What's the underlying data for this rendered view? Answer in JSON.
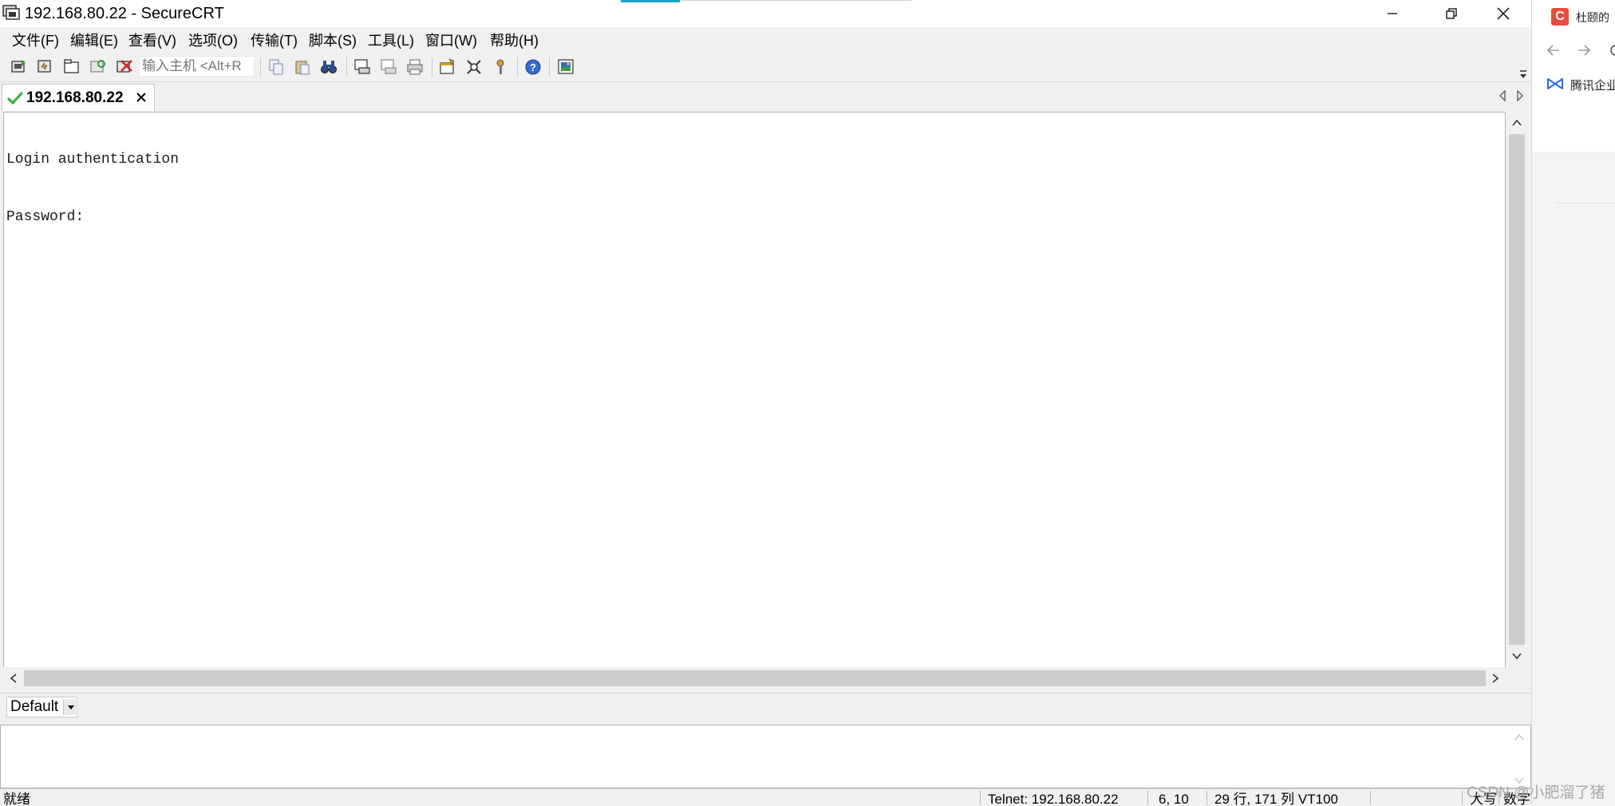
{
  "window": {
    "title": "192.168.80.22 - SecureCRT"
  },
  "menu": {
    "items": [
      "文件(F)",
      "编辑(E)",
      "查看(V)",
      "选项(O)",
      "传输(T)",
      "脚本(S)",
      "工具(L)",
      "窗口(W)",
      "帮助(H)"
    ]
  },
  "toolbar": {
    "quick_connect_placeholder": "输入主机 <Alt+R"
  },
  "tabs": [
    {
      "label": "192.168.80.22",
      "status": "connected"
    }
  ],
  "terminal": {
    "lines": [
      "Login authentication",
      "Password:"
    ]
  },
  "session_bar": {
    "selected": "Default"
  },
  "status_bar": {
    "ready": "就绪",
    "connection": "Telnet: 192.168.80.22",
    "cursor": "6, 10",
    "size": "29 行, 171 列 VT100",
    "caps": "大写",
    "num": "数字"
  },
  "side_panel": {
    "tab_text": "杜颐的",
    "bookmark_text": "腾讯企业"
  },
  "watermark": "CSDN @小肥溜了猪",
  "colors": {
    "accent": "#1ca3c8",
    "check_green": "#3cb043",
    "csdn_red": "#e84c3d",
    "bookmark_blue": "#2b6cd6"
  }
}
